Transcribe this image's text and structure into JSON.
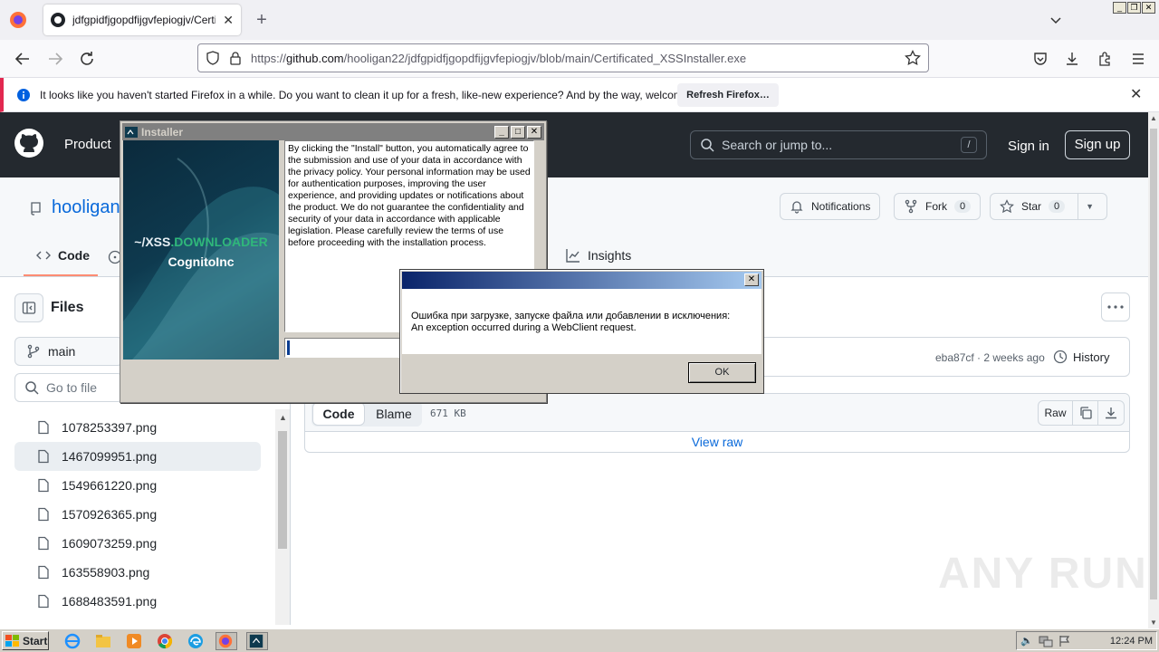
{
  "browser": {
    "tab_title": "jdfgpidfjgopdfijgvfepiogjv/Certifica",
    "url_prefix": "https://",
    "url_domain": "github.com",
    "url_path": "/hooligan22/jdfgpidfjgopdfijgvfepiogjv/blob/main/Certificated_XSSInstaller.exe",
    "notification": "It looks like you haven't started Firefox in a while. Do you want to clean it up for a fresh, like-new experience? And by the way, welcome back!",
    "refresh_label": "Refresh Firefox…"
  },
  "github": {
    "product": "Product",
    "search_placeholder": "Search or jump to...",
    "search_shortcut": "/",
    "signin": "Sign in",
    "signup": "Sign up",
    "repo_owner": "hooligan",
    "notifications": "Notifications",
    "fork": "Fork",
    "fork_count": "0",
    "star": "Star",
    "star_count": "0",
    "tab_code": "Code",
    "tab_insights": "Insights",
    "files_title": "Files",
    "branch": "main",
    "goto_file": "Go to file",
    "files": [
      "1078253397.png",
      "1467099951.png",
      "1549661220.png",
      "1570926365.png",
      "1609073259.png",
      "163558903.png",
      "1688483591.png"
    ],
    "commit_meta": "eba87cf · 2 weeks ago",
    "history": "History",
    "btn_code": "Code",
    "btn_blame": "Blame",
    "file_size": "671 KB",
    "raw": "Raw",
    "view_raw": "View raw"
  },
  "installer": {
    "title": "Installer",
    "brand_prefix": "~/XSS",
    "brand_suffix": ".DOWNLOADER",
    "brand_sub": "CognitoInc",
    "terms": "By clicking the \"Install\" button, you automatically agree to the submission and use of your data in accordance with the privacy policy. Your personal information may be used for authentication purposes, improving the user experience, and providing updates or notifications about the product. We do not guarantee the confidentiality and security of your data in accordance with applicable legislation. Please carefully review the terms of use before proceeding with the installation process."
  },
  "error_dialog": {
    "line1": "Ошибка при загрузке, запуске файла или добавлении в исключения:",
    "line2": "An exception occurred during a WebClient request.",
    "ok": "OK"
  },
  "taskbar": {
    "start": "Start",
    "clock": "12:24 PM"
  },
  "watermark": "ANY RUN"
}
